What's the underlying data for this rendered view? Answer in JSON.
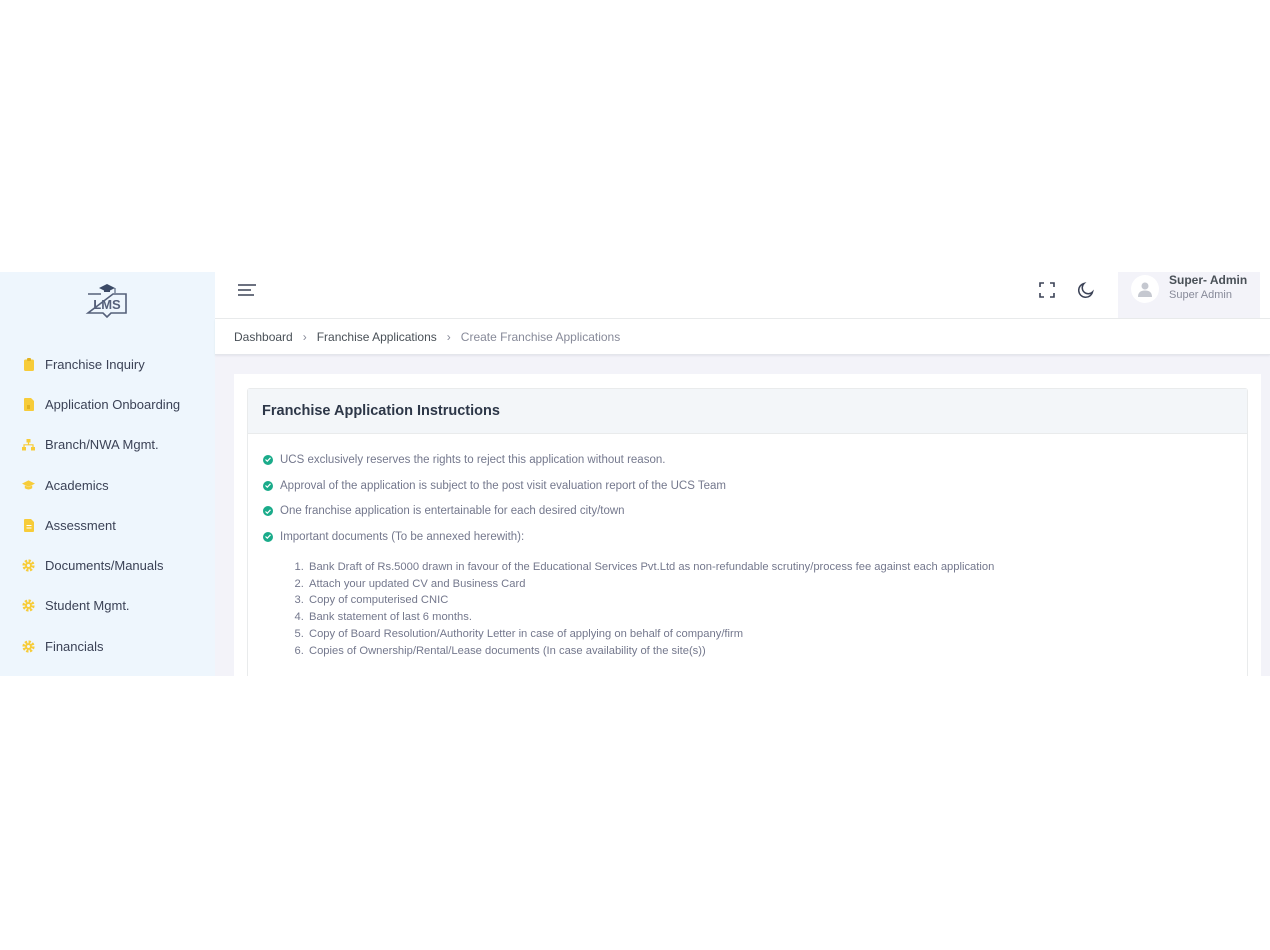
{
  "app": {
    "logo_text": "LMS"
  },
  "sidebar": {
    "items": [
      {
        "label": "Franchise Inquiry",
        "icon": "clipboard-icon"
      },
      {
        "label": "Application Onboarding",
        "icon": "file-icon"
      },
      {
        "label": "Branch/NWA Mgmt.",
        "icon": "sitemap-icon"
      },
      {
        "label": "Academics",
        "icon": "graduation-cap-icon"
      },
      {
        "label": "Assessment",
        "icon": "document-icon"
      },
      {
        "label": "Documents/Manuals",
        "icon": "gear-icon"
      },
      {
        "label": "Student Mgmt.",
        "icon": "gear-icon"
      },
      {
        "label": "Financials",
        "icon": "gear-icon"
      }
    ],
    "icon_color": "#f7cc39"
  },
  "header": {
    "user_name": "Super- Admin",
    "user_role": "Super Admin"
  },
  "breadcrumb": {
    "items": [
      "Dashboard",
      "Franchise Applications"
    ],
    "active": "Create Franchise Applications"
  },
  "instructions": {
    "title": "Franchise Application Instructions",
    "points": [
      "UCS exclusively reserves the rights to reject this application without reason.",
      "Approval of the application is subject to the post visit evaluation report of the UCS Team",
      "One franchise application is entertainable for each desired city/town",
      "Important documents (To be annexed herewith):"
    ],
    "documents": [
      "Bank Draft of Rs.5000 drawn in favour of the Educational Services Pvt.Ltd as non-refundable scrutiny/process fee against each application",
      "Attach your updated CV and Business Card",
      "Copy of computerised CNIC",
      "Bank statement of last 6 months.",
      "Copy of Board Resolution/Authority Letter in case of applying on behalf of company/firm",
      "Copies of Ownership/Rental/Lease documents (In case availability of the site(s))"
    ]
  },
  "colors": {
    "sidebar_bg": "#eef6fd",
    "accent_check": "#1aab8a",
    "icon_yellow": "#f7cc39"
  }
}
